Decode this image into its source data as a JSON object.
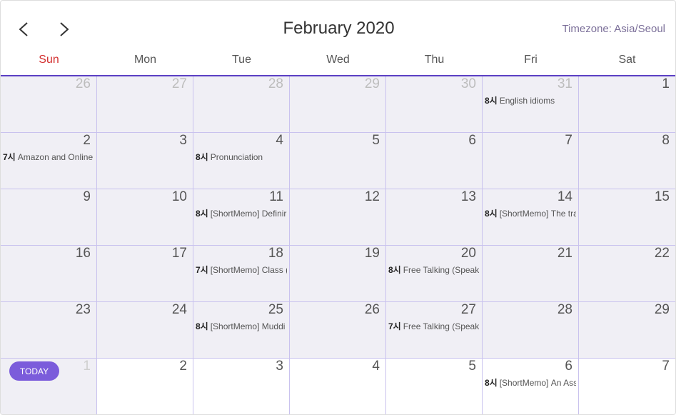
{
  "header": {
    "title": "February 2020",
    "timezone": "Timezone: Asia/Seoul",
    "prev_icon": "chevron-left-icon",
    "next_icon": "chevron-right-icon"
  },
  "weekdays": [
    "Sun",
    "Mon",
    "Tue",
    "Wed",
    "Thu",
    "Fri",
    "Sat"
  ],
  "today_label": "TODAY",
  "weeks": [
    [
      {
        "day": "26",
        "other": true
      },
      {
        "day": "27",
        "other": true
      },
      {
        "day": "28",
        "other": true
      },
      {
        "day": "29",
        "other": true
      },
      {
        "day": "30",
        "other": true
      },
      {
        "day": "31",
        "other": true,
        "event": {
          "time": "8시",
          "text": "English idioms"
        }
      },
      {
        "day": "1"
      }
    ],
    [
      {
        "day": "2",
        "event": {
          "time": "7시",
          "text": "Amazon and Online"
        }
      },
      {
        "day": "3"
      },
      {
        "day": "4",
        "event": {
          "time": "8시",
          "text": "Pronunciation"
        }
      },
      {
        "day": "5"
      },
      {
        "day": "6"
      },
      {
        "day": "7"
      },
      {
        "day": "8"
      }
    ],
    [
      {
        "day": "9"
      },
      {
        "day": "10"
      },
      {
        "day": "11",
        "event": {
          "time": "8시",
          "text": "[ShortMemo] Definir"
        }
      },
      {
        "day": "12"
      },
      {
        "day": "13"
      },
      {
        "day": "14",
        "event": {
          "time": "8시",
          "text": "[ShortMemo] The tra"
        }
      },
      {
        "day": "15"
      }
    ],
    [
      {
        "day": "16"
      },
      {
        "day": "17"
      },
      {
        "day": "18",
        "event": {
          "time": "7시",
          "text": "[ShortMemo] Class ("
        }
      },
      {
        "day": "19"
      },
      {
        "day": "20",
        "event": {
          "time": "8시",
          "text": "Free Talking (Speaki"
        }
      },
      {
        "day": "21"
      },
      {
        "day": "22"
      }
    ],
    [
      {
        "day": "23"
      },
      {
        "day": "24"
      },
      {
        "day": "25",
        "event": {
          "time": "8시",
          "text": "[ShortMemo] Muddi"
        }
      },
      {
        "day": "26"
      },
      {
        "day": "27",
        "event": {
          "time": "7시",
          "text": "Free Talking (Speaki"
        }
      },
      {
        "day": "28"
      },
      {
        "day": "29"
      }
    ],
    [
      {
        "day": "1",
        "today": true
      },
      {
        "day": "2",
        "future": true
      },
      {
        "day": "3",
        "future": true
      },
      {
        "day": "4",
        "future": true
      },
      {
        "day": "5",
        "future": true
      },
      {
        "day": "6",
        "future": true,
        "event": {
          "time": "8시",
          "text": "[ShortMemo] An Ass"
        }
      },
      {
        "day": "7",
        "future": true
      }
    ]
  ]
}
